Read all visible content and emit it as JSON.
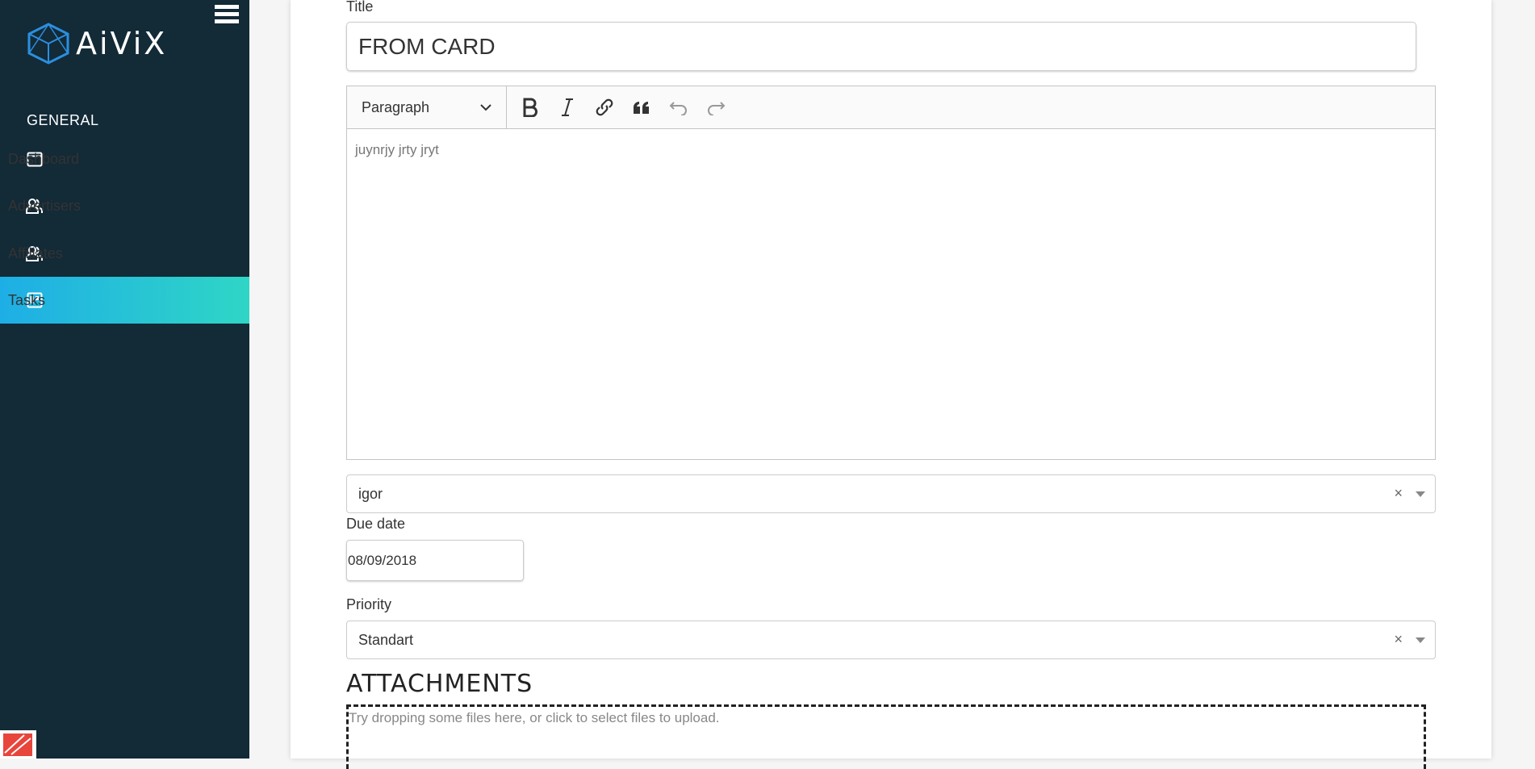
{
  "brand": {
    "name": "AiViX"
  },
  "sidebar": {
    "section": "GENERAL",
    "items": [
      {
        "label": "Dashboard",
        "icon": "calendar-icon"
      },
      {
        "label": "Advertisers",
        "icon": "users-icon"
      },
      {
        "label": "Affiliates",
        "icon": "users-icon"
      },
      {
        "label": "Tasks",
        "icon": "board-icon",
        "active": true
      }
    ]
  },
  "form": {
    "title_label": "Title",
    "title_value": "FROM CARD",
    "editor": {
      "paragraph_label": "Paragraph",
      "content": "juynrjy jrty jryt"
    },
    "assignee": {
      "value": "igor",
      "clear": "×"
    },
    "due_date_label": "Due date",
    "due_date_value": "08/09/2018",
    "priority_label": "Priority",
    "priority": {
      "value": "Standart",
      "clear": "×"
    },
    "attachments_title": "ATTACHMENTS",
    "dropzone_text": "Try dropping some files here, or click to select files to upload."
  },
  "colors": {
    "sidebar_bg": "#132a37",
    "active_gradient_start": "#1eaee6",
    "active_gradient_end": "#2fd6c6",
    "logo_blue": "#2b8fe0"
  }
}
